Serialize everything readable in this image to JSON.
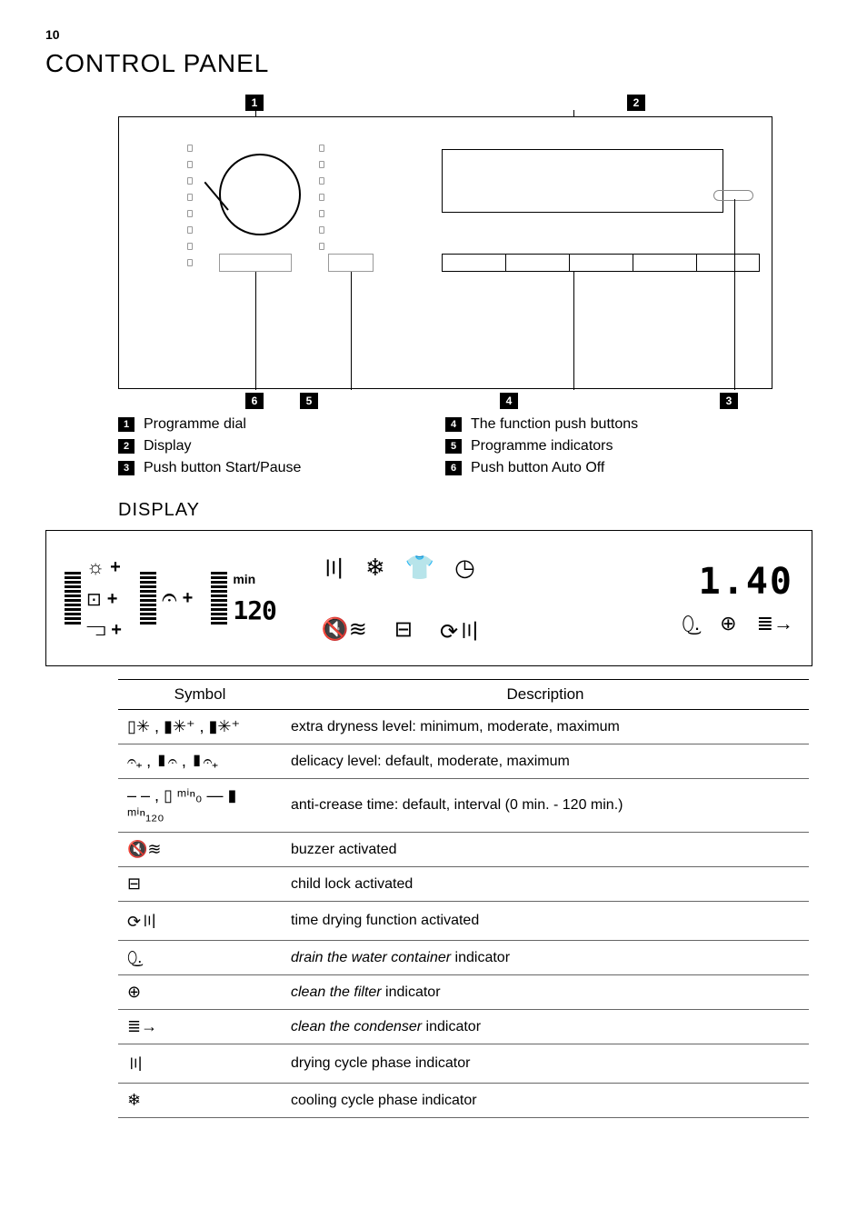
{
  "page_number": "10",
  "title": "CONTROL PANEL",
  "callouts": {
    "c1": "1",
    "c2": "2",
    "c3": "3",
    "c4": "4",
    "c5": "5",
    "c6": "6"
  },
  "legend": {
    "l1": "Programme dial",
    "l2": "Display",
    "l3": "Push button Start/Pause",
    "l4": "The function push buttons",
    "l5": "Programme indicators",
    "l6": "Push button Auto Off"
  },
  "display_section_title": "DISPLAY",
  "display_example": {
    "min_label": "min",
    "min_value": "120",
    "time_value": "1.40"
  },
  "table": {
    "head_symbol": "Symbol",
    "head_desc": "Description",
    "rows": [
      {
        "sym": "▯✳ , ▮✳⁺ , ▮✳⁺",
        "desc": "extra dryness level: minimum, moderate, maximum"
      },
      {
        "sym": "𝄐₊ , ▮𝄐 , ▮𝄐₊",
        "desc": "delicacy level: default, moderate, maximum"
      },
      {
        "sym": "– – , ▯ ᵐⁱⁿ₀ — ▮ ᵐⁱⁿ₁₂₀",
        "desc": "anti-crease time: default, interval (0 min. - 120 min.)"
      },
      {
        "sym": "🔇≋",
        "desc": "buzzer activated"
      },
      {
        "sym": "⊟",
        "desc": "child lock activated"
      },
      {
        "sym": "⟳〣",
        "desc": "time drying function activated"
      },
      {
        "sym": "⬯͜.",
        "desc_html": "<span class='italic'>drain the water container</span> indicator"
      },
      {
        "sym": "⊕",
        "desc_html": "<span class='italic'>clean the filter</span> indicator"
      },
      {
        "sym": "≣→",
        "desc_html": "<span class='italic'>clean the condenser</span> indicator"
      },
      {
        "sym": "〣",
        "desc": "drying cycle phase indicator"
      },
      {
        "sym": "❄︎",
        "desc": "cooling cycle phase indicator"
      }
    ]
  }
}
